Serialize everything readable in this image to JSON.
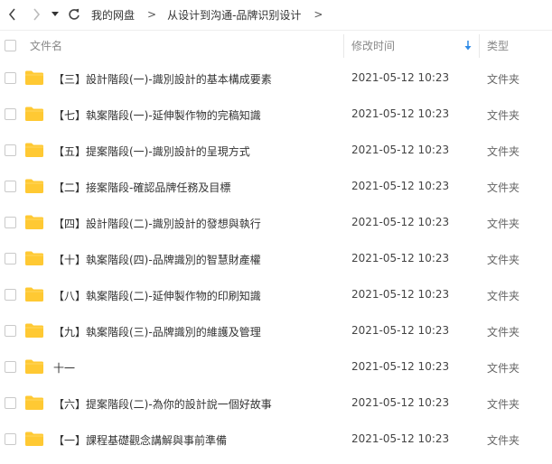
{
  "breadcrumb": {
    "root": "我的网盘",
    "current": "从设计到沟通-品牌识别设计",
    "separator": ">"
  },
  "header": {
    "name_label": "文件名",
    "time_label": "修改时间",
    "type_label": "类型"
  },
  "colors": {
    "folder": "#FFC933",
    "sort_arrow": "#2e8ae6"
  },
  "files": [
    {
      "name": "【三】設計階段(一)-識別設計的基本構成要素",
      "modified": "2021-05-12 10:23",
      "type": "文件夹"
    },
    {
      "name": "【七】執案階段(一)-延伸製作物的完稿知識",
      "modified": "2021-05-12 10:23",
      "type": "文件夹"
    },
    {
      "name": "【五】提案階段(一)-識別設計的呈現方式",
      "modified": "2021-05-12 10:23",
      "type": "文件夹"
    },
    {
      "name": "【二】接案階段-確認品牌任務及目標",
      "modified": "2021-05-12 10:23",
      "type": "文件夹"
    },
    {
      "name": "【四】設計階段(二)-識別設計的發想與執行",
      "modified": "2021-05-12 10:23",
      "type": "文件夹"
    },
    {
      "name": "【十】執案階段(四)-品牌識別的智慧財產權",
      "modified": "2021-05-12 10:23",
      "type": "文件夹"
    },
    {
      "name": "【八】執案階段(二)-延伸製作物的印刷知識",
      "modified": "2021-05-12 10:23",
      "type": "文件夹"
    },
    {
      "name": "【九】執案階段(三)-品牌識別的維護及管理",
      "modified": "2021-05-12 10:23",
      "type": "文件夹"
    },
    {
      "name": "十一",
      "modified": "2021-05-12 10:23",
      "type": "文件夹"
    },
    {
      "name": "【六】提案階段(二)-為你的設計說一個好故事",
      "modified": "2021-05-12 10:23",
      "type": "文件夹"
    },
    {
      "name": "【一】課程基礎觀念講解與事前準備",
      "modified": "2021-05-12 10:23",
      "type": "文件夹"
    }
  ]
}
